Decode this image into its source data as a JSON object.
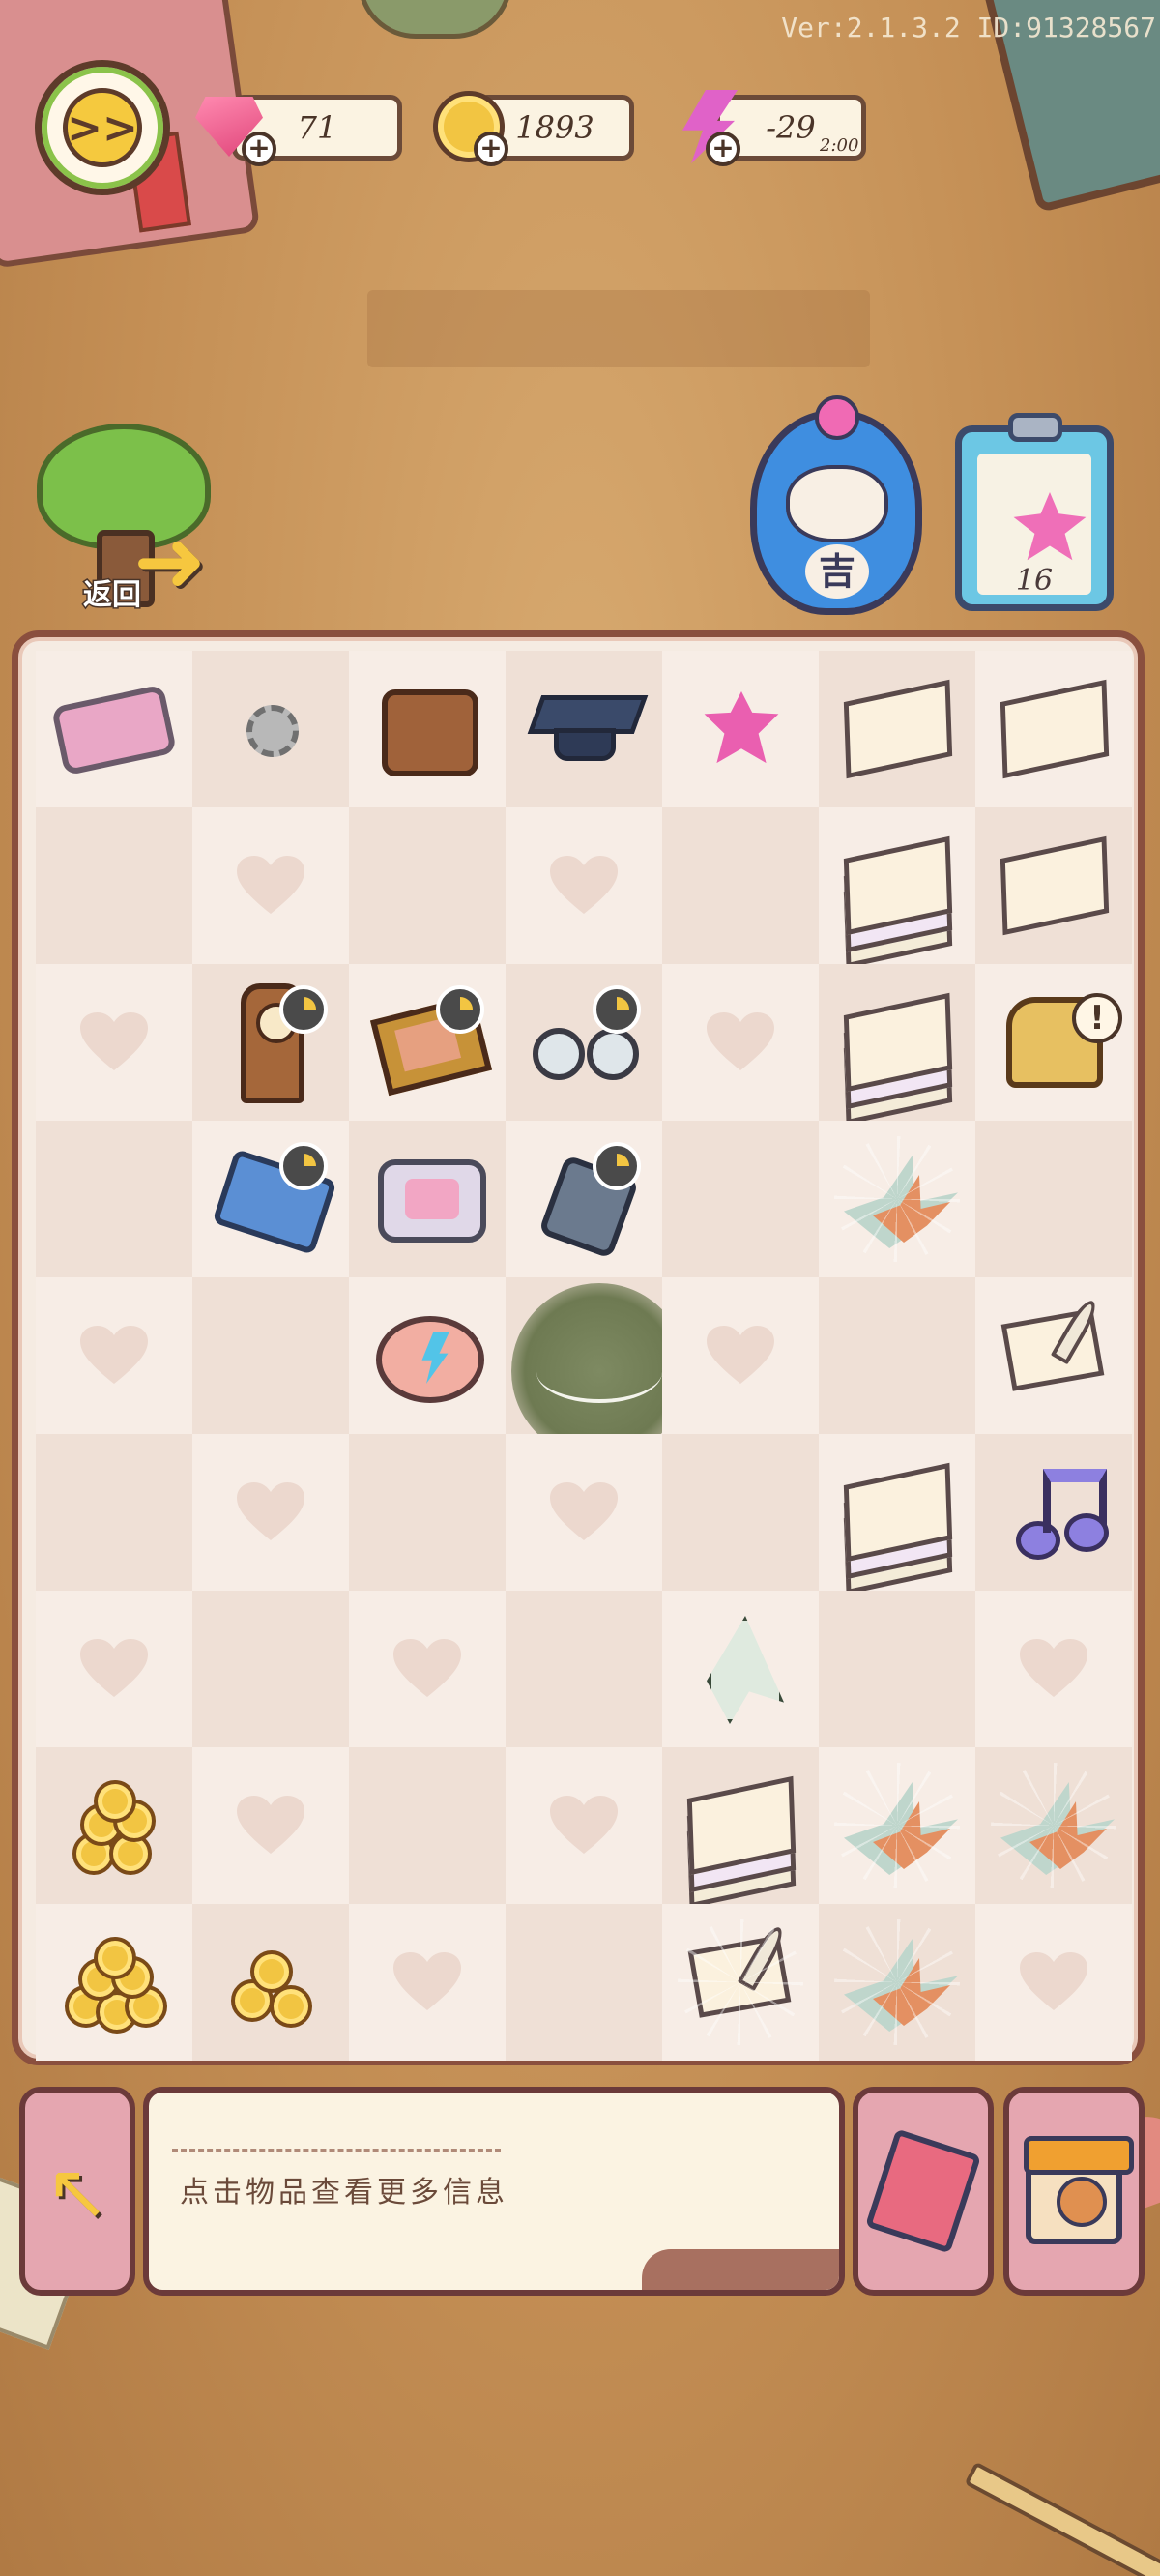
{
  "header": {
    "version": "Ver:2.1.3.2 ID:91328567",
    "gems": "71",
    "coins": "1893",
    "energy": "-29",
    "energy_timer": "2:00",
    "avatar_glyph": ">>"
  },
  "actions": {
    "return_label": "返回",
    "daruma_char": "吉",
    "clipboard_count": "16"
  },
  "board": {
    "cols": 7,
    "rows": 9,
    "cells": [
      [
        "tablet",
        "gear",
        "bag",
        "cap",
        "flower",
        "paper",
        "paper"
      ],
      [
        "empty",
        "heart",
        "empty",
        "heart",
        "empty",
        "paper-stack",
        "paper"
      ],
      [
        "heart",
        "clock-timer",
        "frame-timer",
        "glasses-timer",
        "heart",
        "paper-stack",
        "piano-alert"
      ],
      [
        "empty",
        "book-timer",
        "device",
        "walkie-timer",
        "empty",
        "crane-web",
        "empty"
      ],
      [
        "heart",
        "empty",
        "pig",
        "web-selected",
        "heart",
        "empty",
        "letter-quill"
      ],
      [
        "empty",
        "heart",
        "empty",
        "heart",
        "empty",
        "paper-stack",
        "music-note"
      ],
      [
        "heart",
        "empty",
        "heart",
        "empty",
        "paper-plane",
        "empty",
        "heart"
      ],
      [
        "coin-stack",
        "heart",
        "empty",
        "heart",
        "paper-stack",
        "crane-web",
        "crane-web"
      ],
      [
        "coin-pile",
        "coin-pile-small",
        "heart",
        "empty",
        "letter-web",
        "crane-web",
        "heart"
      ]
    ]
  },
  "info": {
    "hint": "点击物品查看更多信息"
  },
  "colors": {
    "board_border": "#8a4f3e",
    "button_pink": "#e5a6b0",
    "accent_gold": "#f6c73f"
  }
}
